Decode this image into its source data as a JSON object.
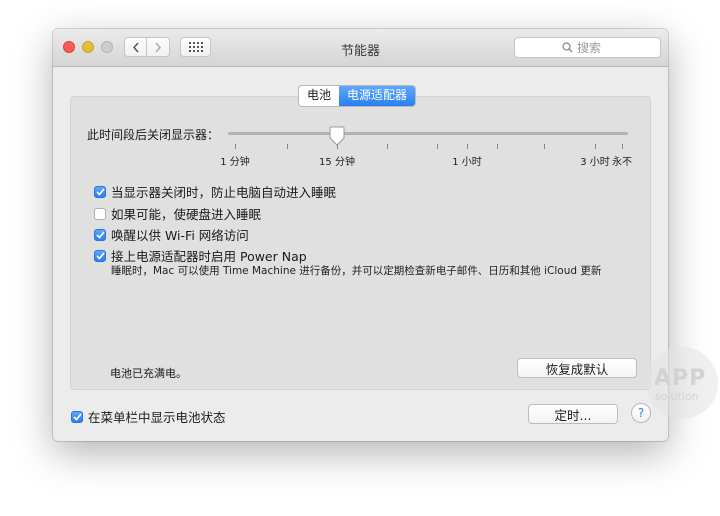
{
  "window": {
    "title": "节能器"
  },
  "search": {
    "placeholder": "搜索"
  },
  "tabs": [
    {
      "label": "电池",
      "active": false
    },
    {
      "label": "电源适配器",
      "active": true
    }
  ],
  "slider": {
    "label": "此时间段后关闭显示器：",
    "value_label": "15 分钟",
    "tick_labels": [
      "1 分钟",
      "15 分钟",
      "1 小时",
      "3 小时",
      "永不"
    ]
  },
  "options": [
    {
      "label": "当显示器关闭时，防止电脑自动进入睡眠",
      "checked": true
    },
    {
      "label": "如果可能，使硬盘进入睡眠",
      "checked": false
    },
    {
      "label": "唤醒以供 Wi-Fi 网络访问",
      "checked": true
    },
    {
      "label": "接上电源适配器时启用 Power Nap",
      "checked": true
    }
  ],
  "power_nap_description": "睡眠时，Mac 可以使用 Time Machine 进行备份，并可以定期检查新电子邮件、日历和其他 iCloud 更新",
  "status": "电池已充满电。",
  "buttons": {
    "restore_defaults": "恢复成默认",
    "schedule": "定时...",
    "help": "?"
  },
  "menubar_option": {
    "label": "在菜单栏中显示电池状态",
    "checked": true
  },
  "watermark": {
    "line1": "APP",
    "line2": "solution"
  },
  "colors": {
    "accent": "#2a7ff0",
    "close": "#fc5b57",
    "minimize": "#e5bf3c"
  }
}
